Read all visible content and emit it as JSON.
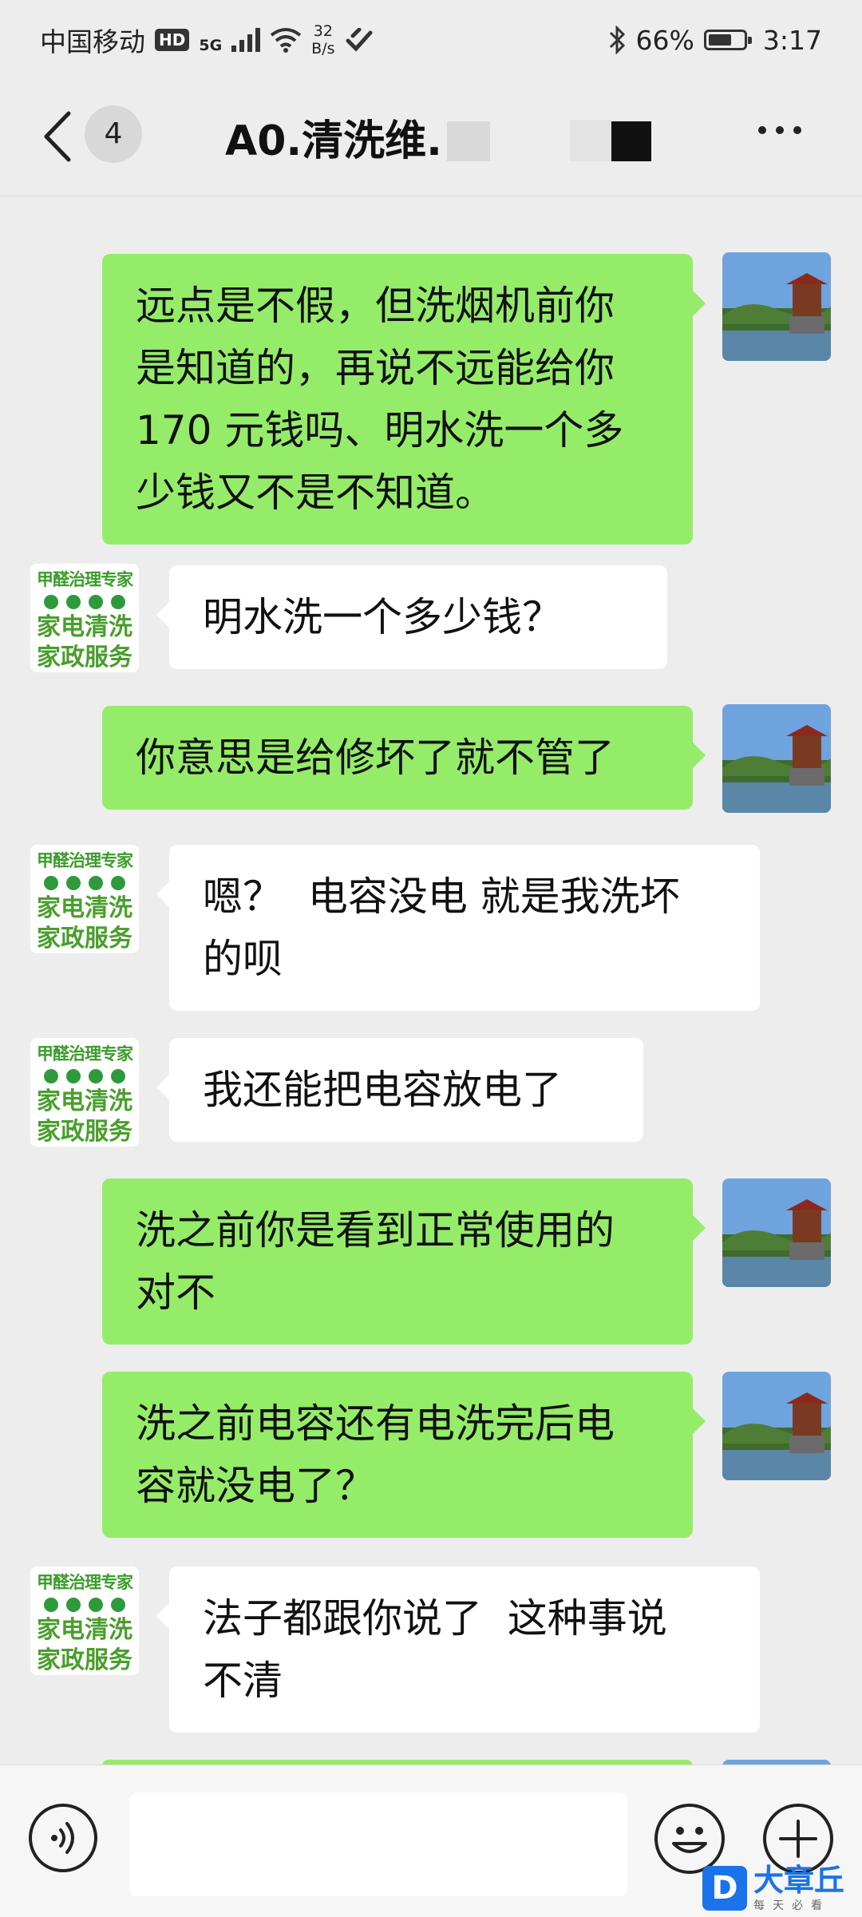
{
  "status_bar": {
    "carrier": "中国移动",
    "hd": "HD",
    "network": "5G",
    "speed_value": "32",
    "speed_unit": "B/s",
    "battery_percent": "66%",
    "battery_level": 0.66,
    "time": "3:17"
  },
  "header": {
    "unread_count": "4",
    "chat_title": "A0.清洗维."
  },
  "messages": [
    {
      "sender": "me",
      "text": "远点是不假，但洗烟机前你\n是知道的，再说不远能给你\n170 元钱吗、明水洗一个多\n少钱又不是不知道。"
    },
    {
      "sender": "other",
      "text": "明水洗一个多少钱？"
    },
    {
      "sender": "me",
      "text": "你意思是给修坏了就不管了"
    },
    {
      "sender": "other",
      "text": "嗯？  电容没电 就是我洗坏\n的呗"
    },
    {
      "sender": "other",
      "text": "我还能把电容放电了"
    },
    {
      "sender": "me",
      "text": "洗之前你是看到正常使用的\n对不"
    },
    {
      "sender": "me",
      "text": "洗之前电容还有电洗完后电\n容就没电了？"
    },
    {
      "sender": "other",
      "text": "法子都跟你说了  这种事说\n不清"
    }
  ],
  "business_avatar": {
    "line1": "甲醛治理专家",
    "line2": "家电清洗",
    "line3": "家政服务"
  },
  "input_bar": {
    "placeholder": ""
  },
  "watermark": {
    "logo_letter": "D",
    "name": "大章丘",
    "tagline": "每天必看"
  },
  "colors": {
    "my_bubble": "#95ec69",
    "other_bubble": "#ffffff",
    "background": "#ededed"
  }
}
